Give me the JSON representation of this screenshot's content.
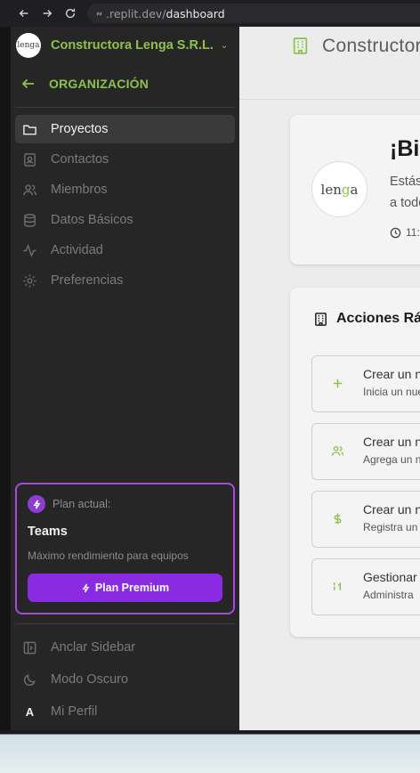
{
  "browser": {
    "url_dim": ".replit.dev/",
    "url_path": "dashboard"
  },
  "sidebar": {
    "org_logo_text": "lenga",
    "org_name": "Constructora Lenga S.R.L.",
    "section": "ORGANIZACIÓN",
    "items": [
      {
        "label": "Proyectos",
        "icon": "folder-icon",
        "active": true
      },
      {
        "label": "Contactos",
        "icon": "contact-icon"
      },
      {
        "label": "Miembros",
        "icon": "users-icon"
      },
      {
        "label": "Datos Básicos",
        "icon": "database-icon"
      },
      {
        "label": "Actividad",
        "icon": "activity-icon"
      },
      {
        "label": "Preferencias",
        "icon": "gear-icon"
      }
    ],
    "plan": {
      "label": "Plan actual:",
      "name": "Teams",
      "description": "Máximo rendimiento para equipos",
      "button": "Plan Premium"
    },
    "bottom": {
      "pin": "Anclar Sidebar",
      "dark": "Modo Oscuro",
      "profile_initial": "A",
      "profile": "Mi Perfil"
    }
  },
  "main": {
    "title": "Constructora Lenga S.R.L.",
    "welcome": {
      "heading": "¡Bienvenido",
      "line1": "Estás",
      "line2": "a todo",
      "time": "11:"
    },
    "actions_title": "Acciones Rápidas",
    "actions": [
      {
        "title": "Crear un nuevo",
        "desc": "Inicia un nuevo",
        "icon": "plus-icon"
      },
      {
        "title": "Crear un nuevo",
        "desc": "Agrega un nuevo",
        "icon": "users-icon"
      },
      {
        "title": "Crear un nuevo",
        "desc": "Registra un",
        "icon": "dollar-icon"
      },
      {
        "title": "Gestionar",
        "desc": "Administra",
        "icon": "tool-icon"
      }
    ]
  },
  "colors": {
    "accent_green": "#8bc34a",
    "plan_purple": "#8a2be2",
    "sidebar_bg": "#262626",
    "main_bg": "#ececec"
  }
}
